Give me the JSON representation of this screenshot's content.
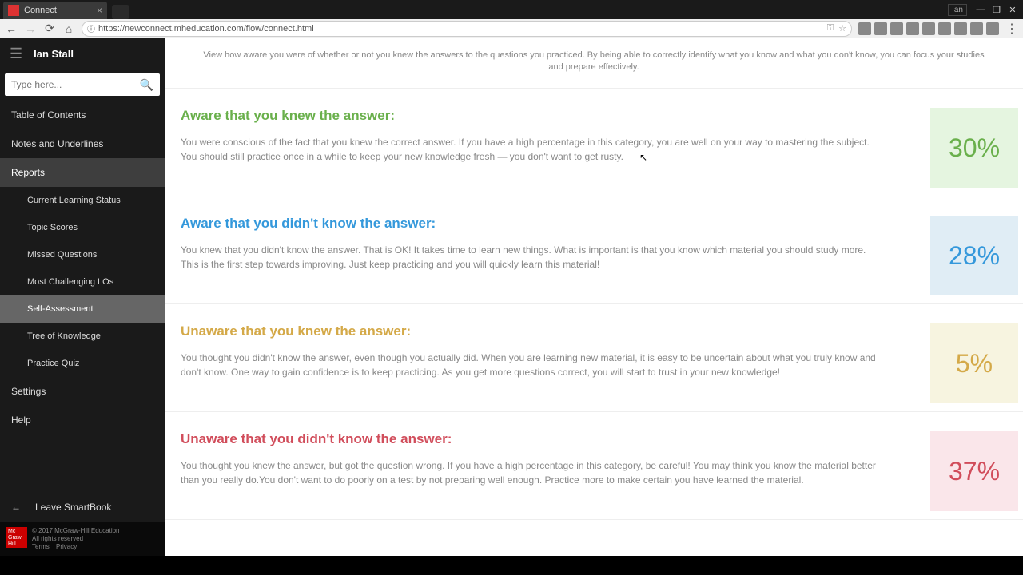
{
  "browser": {
    "tab_title": "Connect",
    "url": "https://newconnect.mheducation.com/flow/connect.html",
    "user_badge": "Ian"
  },
  "sidebar": {
    "username": "Ian Stall",
    "search_placeholder": "Type here...",
    "items": {
      "toc": "Table of Contents",
      "notes": "Notes and Underlines",
      "reports": "Reports",
      "settings": "Settings",
      "help": "Help"
    },
    "report_subs": [
      "Current Learning Status",
      "Topic Scores",
      "Missed Questions",
      "Most Challenging LOs",
      "Self-Assessment",
      "Tree of Knowledge",
      "Practice Quiz"
    ],
    "leave": "Leave SmartBook",
    "copyright_line1": "© 2017 McGraw-Hill Education",
    "copyright_line2": "All rights reserved",
    "terms": "Terms",
    "privacy": "Privacy"
  },
  "content": {
    "intro": "View how aware you were of whether or not you knew the answers to the questions you practiced. By being able to correctly identify what you know and what you don't know, you can focus your studies and prepare effectively.",
    "sections": [
      {
        "title": "Aware that you knew the answer:",
        "desc": "You were conscious of the fact that you knew the correct answer. If you have a high percentage in this category, you are well on your way to mastering the subject. You should still practice once in a while to keep your new knowledge fresh — you don't want to get rusty.",
        "pct": "30%"
      },
      {
        "title": "Aware that you didn't know the answer:",
        "desc": "You knew that you didn't know the answer. That is OK! It takes time to learn new things. What is important is that you know which material you should study more. This is the first step towards improving. Just keep practicing and you will quickly learn this material!",
        "pct": "28%"
      },
      {
        "title": "Unaware that you knew the answer:",
        "desc": "You thought you didn't know the answer, even though you actually did. When you are learning new material, it is easy to be uncertain about what you truly know and don't know. One way to gain confidence is to keep practicing. As you get more questions correct, you will start to trust in your new knowledge!",
        "pct": "5%"
      },
      {
        "title": "Unaware that you didn't know the answer:",
        "desc": "You thought you knew the answer, but got the question wrong. If you have a high percentage in this category, be careful! You may think you know the material better than you really do.You don't want to do poorly on a test by not preparing well enough. Practice more to make certain you have learned the material.",
        "pct": "37%"
      }
    ]
  }
}
